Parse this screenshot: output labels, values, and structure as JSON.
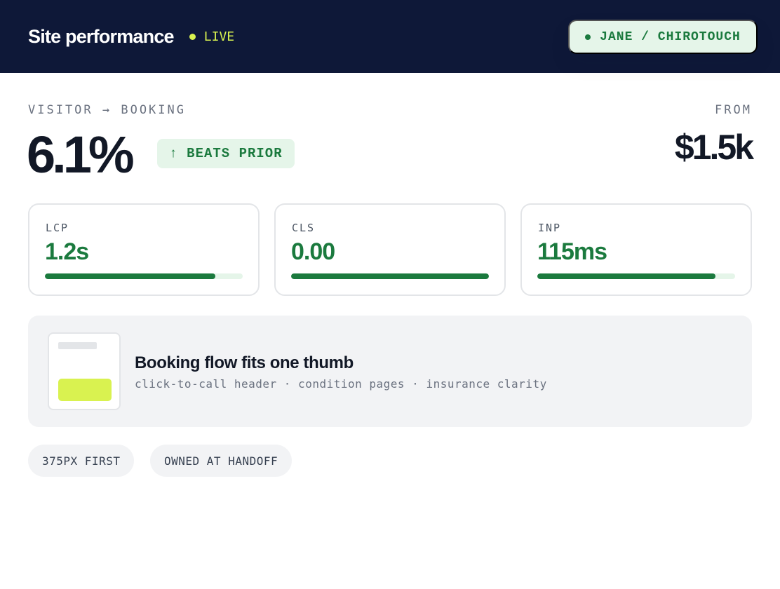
{
  "header": {
    "title": "Site performance",
    "status": "LIVE",
    "account": "JANE / CHIROTOUCH"
  },
  "summary": {
    "metric_label": "VISITOR → BOOKING",
    "metric_value": "6.1%",
    "badge": "↑ BEATS PRIOR",
    "from_label": "FROM",
    "price": "$1.5k"
  },
  "vitals": [
    {
      "label": "LCP",
      "value": "1.2s",
      "bar_fraction": 0.86
    },
    {
      "label": "CLS",
      "value": "0.00",
      "bar_fraction": 1.0
    },
    {
      "label": "INP",
      "value": "115ms",
      "bar_fraction": 0.9
    }
  ],
  "feature": {
    "title": "Booking flow fits one thumb",
    "subtitle": "click-to-call header · condition pages · insurance clarity"
  },
  "chips": [
    "375PX FIRST",
    "OWNED AT HANDOFF"
  ],
  "colors": {
    "navy": "#0e1838",
    "accent_lime": "#d9f250",
    "green": "#1b7a3e",
    "mint": "#e5f5e9"
  }
}
